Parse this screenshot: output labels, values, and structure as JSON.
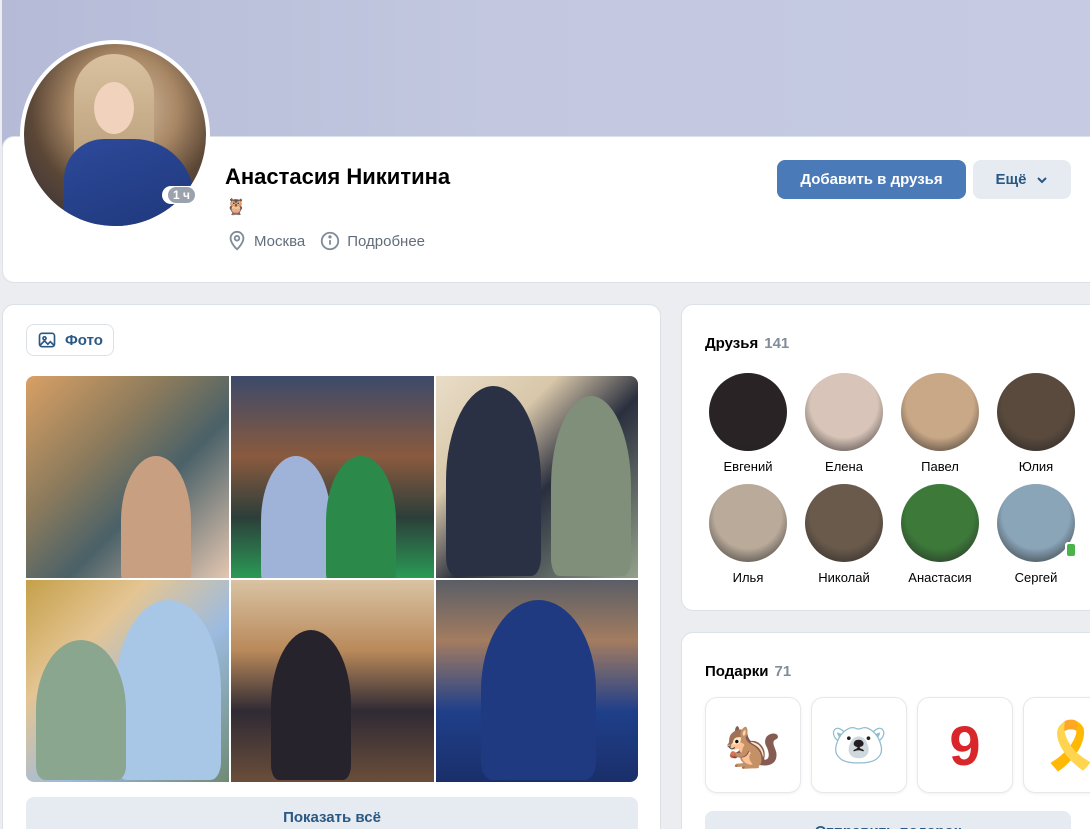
{
  "profile": {
    "name": "Анастасия Никитина",
    "status_emoji": "🦉",
    "online_badge": "1 ч",
    "city": "Москва",
    "details_link": "Подробнее",
    "add_friend_label": "Добавить в друзья",
    "more_label": "Ещё"
  },
  "photos": {
    "tab_label": "Фото",
    "show_all_label": "Показать всё"
  },
  "friends": {
    "title": "Друзья",
    "count": "141",
    "items": [
      {
        "name": "Евгений",
        "color": "#2a2326"
      },
      {
        "name": "Елена",
        "color": "#d8c4b8"
      },
      {
        "name": "Павел",
        "color": "#c9a887"
      },
      {
        "name": "Юлия",
        "color": "#5a4a3d"
      },
      {
        "name": "Илья",
        "color": "#b9aa9a"
      },
      {
        "name": "Николай",
        "color": "#6a5a4c"
      },
      {
        "name": "Анастасия",
        "color": "#3d7a3a"
      },
      {
        "name": "Сергей",
        "color": "#8aa4b8"
      }
    ]
  },
  "gifts": {
    "title": "Подарки",
    "count": "71",
    "items": [
      "🐿️",
      "🐻‍❄️",
      "9",
      "🎗️"
    ],
    "send_label": "Отправить подарок"
  },
  "colors": {
    "accent": "#4a7ab8",
    "link": "#2a5885",
    "secondary_bg": "#e5ebf1",
    "muted": "#818c99",
    "online": "#4bb34b"
  }
}
